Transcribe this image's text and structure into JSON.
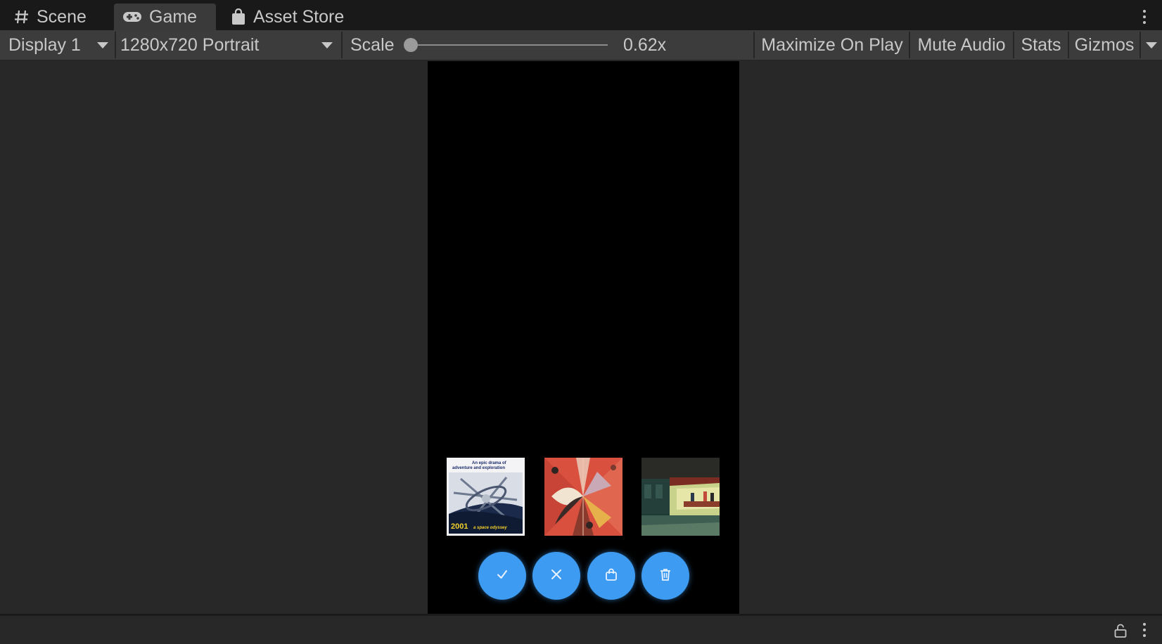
{
  "tabs": [
    {
      "label": "Scene",
      "icon": "hash-icon"
    },
    {
      "label": "Game",
      "icon": "gamepad-icon"
    },
    {
      "label": "Asset Store",
      "icon": "shopping-bag-icon"
    }
  ],
  "toolbar": {
    "display_select": "Display 1",
    "resolution_select": "1280x720 Portrait",
    "scale_label": "Scale",
    "scale_value": "0.62x",
    "maximize_label": "Maximize On Play",
    "mute_label": "Mute Audio",
    "stats_label": "Stats",
    "gizmos_label": "Gizmos"
  },
  "game": {
    "thumbnails": [
      {
        "name": "space-odyssey-poster",
        "tagline": "An epic drama of adventure and exploration",
        "title": "2001",
        "subtitle": "a space odyssey"
      },
      {
        "name": "abstract-geometric-art"
      },
      {
        "name": "nighthawks-painting"
      }
    ],
    "actions": [
      {
        "name": "confirm-button",
        "icon": "check-icon"
      },
      {
        "name": "cancel-button",
        "icon": "close-icon"
      },
      {
        "name": "bag-button",
        "icon": "shopping-bag-icon"
      },
      {
        "name": "delete-button",
        "icon": "trash-icon"
      }
    ],
    "accent": "#3d9bf2"
  }
}
